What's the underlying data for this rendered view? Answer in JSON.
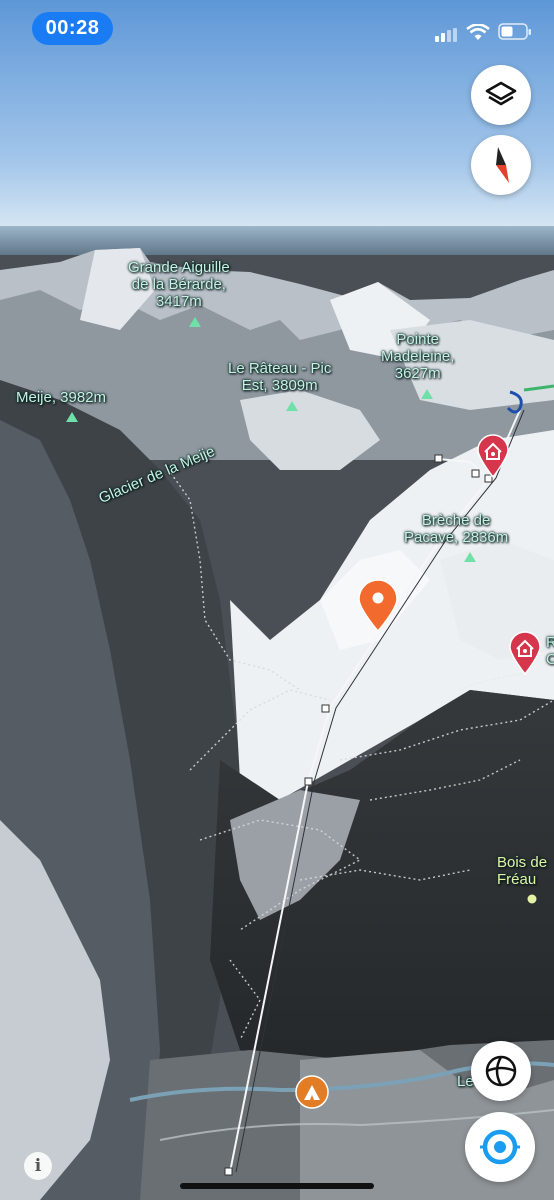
{
  "status_bar": {
    "time": "00:28",
    "colors": {
      "time_pill": "#1a7cf5"
    },
    "icons": [
      "signal-icon",
      "wifi-icon",
      "battery-icon"
    ]
  },
  "map_controls": {
    "icons": [
      "layers-icon",
      "compass-icon",
      "globe-icon",
      "location-icon",
      "info-icon"
    ],
    "info_label": "i"
  },
  "labels": {
    "grande_aiguille": "Grande Aiguille\nde la Bérarde,\n3417m",
    "meije": "Meije, 3982m",
    "rateau": "Le Râteau - Pic\nEst, 3809m",
    "pointe_madeleine": "Pointe\nMadeleine,\n3627m",
    "glacier": "Glacier de la Meije",
    "breche": "Brèche de\nPacave, 2836m",
    "bois": "Bois de\nFréau",
    "refuge_partial": "R\nC",
    "village_partial": "Le      aux"
  },
  "markers": [
    "refuge-marker-icon",
    "refuge-marker-icon",
    "place-pin-icon",
    "campsite-icon"
  ],
  "colors": {
    "label_text": "#c6f3e1",
    "peak_marker": "#6fe1a8",
    "pin": "#f26a2e",
    "refuge": "#d6364b"
  }
}
